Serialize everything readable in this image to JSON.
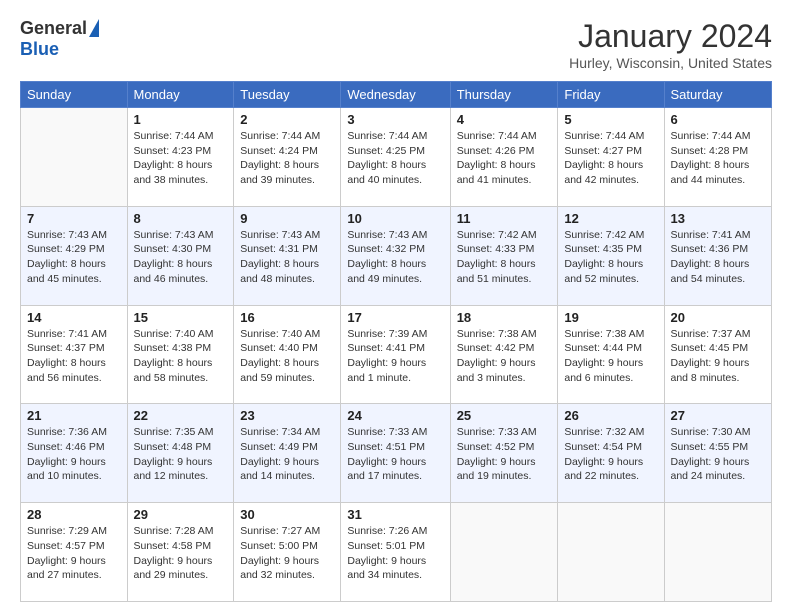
{
  "header": {
    "logo_general": "General",
    "logo_blue": "Blue",
    "title": "January 2024",
    "location": "Hurley, Wisconsin, United States"
  },
  "days_of_week": [
    "Sunday",
    "Monday",
    "Tuesday",
    "Wednesday",
    "Thursday",
    "Friday",
    "Saturday"
  ],
  "weeks": [
    [
      {
        "day": "",
        "sunrise": "",
        "sunset": "",
        "daylight": ""
      },
      {
        "day": "1",
        "sunrise": "Sunrise: 7:44 AM",
        "sunset": "Sunset: 4:23 PM",
        "daylight": "Daylight: 8 hours and 38 minutes."
      },
      {
        "day": "2",
        "sunrise": "Sunrise: 7:44 AM",
        "sunset": "Sunset: 4:24 PM",
        "daylight": "Daylight: 8 hours and 39 minutes."
      },
      {
        "day": "3",
        "sunrise": "Sunrise: 7:44 AM",
        "sunset": "Sunset: 4:25 PM",
        "daylight": "Daylight: 8 hours and 40 minutes."
      },
      {
        "day": "4",
        "sunrise": "Sunrise: 7:44 AM",
        "sunset": "Sunset: 4:26 PM",
        "daylight": "Daylight: 8 hours and 41 minutes."
      },
      {
        "day": "5",
        "sunrise": "Sunrise: 7:44 AM",
        "sunset": "Sunset: 4:27 PM",
        "daylight": "Daylight: 8 hours and 42 minutes."
      },
      {
        "day": "6",
        "sunrise": "Sunrise: 7:44 AM",
        "sunset": "Sunset: 4:28 PM",
        "daylight": "Daylight: 8 hours and 44 minutes."
      }
    ],
    [
      {
        "day": "7",
        "sunrise": "Sunrise: 7:43 AM",
        "sunset": "Sunset: 4:29 PM",
        "daylight": "Daylight: 8 hours and 45 minutes."
      },
      {
        "day": "8",
        "sunrise": "Sunrise: 7:43 AM",
        "sunset": "Sunset: 4:30 PM",
        "daylight": "Daylight: 8 hours and 46 minutes."
      },
      {
        "day": "9",
        "sunrise": "Sunrise: 7:43 AM",
        "sunset": "Sunset: 4:31 PM",
        "daylight": "Daylight: 8 hours and 48 minutes."
      },
      {
        "day": "10",
        "sunrise": "Sunrise: 7:43 AM",
        "sunset": "Sunset: 4:32 PM",
        "daylight": "Daylight: 8 hours and 49 minutes."
      },
      {
        "day": "11",
        "sunrise": "Sunrise: 7:42 AM",
        "sunset": "Sunset: 4:33 PM",
        "daylight": "Daylight: 8 hours and 51 minutes."
      },
      {
        "day": "12",
        "sunrise": "Sunrise: 7:42 AM",
        "sunset": "Sunset: 4:35 PM",
        "daylight": "Daylight: 8 hours and 52 minutes."
      },
      {
        "day": "13",
        "sunrise": "Sunrise: 7:41 AM",
        "sunset": "Sunset: 4:36 PM",
        "daylight": "Daylight: 8 hours and 54 minutes."
      }
    ],
    [
      {
        "day": "14",
        "sunrise": "Sunrise: 7:41 AM",
        "sunset": "Sunset: 4:37 PM",
        "daylight": "Daylight: 8 hours and 56 minutes."
      },
      {
        "day": "15",
        "sunrise": "Sunrise: 7:40 AM",
        "sunset": "Sunset: 4:38 PM",
        "daylight": "Daylight: 8 hours and 58 minutes."
      },
      {
        "day": "16",
        "sunrise": "Sunrise: 7:40 AM",
        "sunset": "Sunset: 4:40 PM",
        "daylight": "Daylight: 8 hours and 59 minutes."
      },
      {
        "day": "17",
        "sunrise": "Sunrise: 7:39 AM",
        "sunset": "Sunset: 4:41 PM",
        "daylight": "Daylight: 9 hours and 1 minute."
      },
      {
        "day": "18",
        "sunrise": "Sunrise: 7:38 AM",
        "sunset": "Sunset: 4:42 PM",
        "daylight": "Daylight: 9 hours and 3 minutes."
      },
      {
        "day": "19",
        "sunrise": "Sunrise: 7:38 AM",
        "sunset": "Sunset: 4:44 PM",
        "daylight": "Daylight: 9 hours and 6 minutes."
      },
      {
        "day": "20",
        "sunrise": "Sunrise: 7:37 AM",
        "sunset": "Sunset: 4:45 PM",
        "daylight": "Daylight: 9 hours and 8 minutes."
      }
    ],
    [
      {
        "day": "21",
        "sunrise": "Sunrise: 7:36 AM",
        "sunset": "Sunset: 4:46 PM",
        "daylight": "Daylight: 9 hours and 10 minutes."
      },
      {
        "day": "22",
        "sunrise": "Sunrise: 7:35 AM",
        "sunset": "Sunset: 4:48 PM",
        "daylight": "Daylight: 9 hours and 12 minutes."
      },
      {
        "day": "23",
        "sunrise": "Sunrise: 7:34 AM",
        "sunset": "Sunset: 4:49 PM",
        "daylight": "Daylight: 9 hours and 14 minutes."
      },
      {
        "day": "24",
        "sunrise": "Sunrise: 7:33 AM",
        "sunset": "Sunset: 4:51 PM",
        "daylight": "Daylight: 9 hours and 17 minutes."
      },
      {
        "day": "25",
        "sunrise": "Sunrise: 7:33 AM",
        "sunset": "Sunset: 4:52 PM",
        "daylight": "Daylight: 9 hours and 19 minutes."
      },
      {
        "day": "26",
        "sunrise": "Sunrise: 7:32 AM",
        "sunset": "Sunset: 4:54 PM",
        "daylight": "Daylight: 9 hours and 22 minutes."
      },
      {
        "day": "27",
        "sunrise": "Sunrise: 7:30 AM",
        "sunset": "Sunset: 4:55 PM",
        "daylight": "Daylight: 9 hours and 24 minutes."
      }
    ],
    [
      {
        "day": "28",
        "sunrise": "Sunrise: 7:29 AM",
        "sunset": "Sunset: 4:57 PM",
        "daylight": "Daylight: 9 hours and 27 minutes."
      },
      {
        "day": "29",
        "sunrise": "Sunrise: 7:28 AM",
        "sunset": "Sunset: 4:58 PM",
        "daylight": "Daylight: 9 hours and 29 minutes."
      },
      {
        "day": "30",
        "sunrise": "Sunrise: 7:27 AM",
        "sunset": "Sunset: 5:00 PM",
        "daylight": "Daylight: 9 hours and 32 minutes."
      },
      {
        "day": "31",
        "sunrise": "Sunrise: 7:26 AM",
        "sunset": "Sunset: 5:01 PM",
        "daylight": "Daylight: 9 hours and 34 minutes."
      },
      {
        "day": "",
        "sunrise": "",
        "sunset": "",
        "daylight": ""
      },
      {
        "day": "",
        "sunrise": "",
        "sunset": "",
        "daylight": ""
      },
      {
        "day": "",
        "sunrise": "",
        "sunset": "",
        "daylight": ""
      }
    ]
  ]
}
